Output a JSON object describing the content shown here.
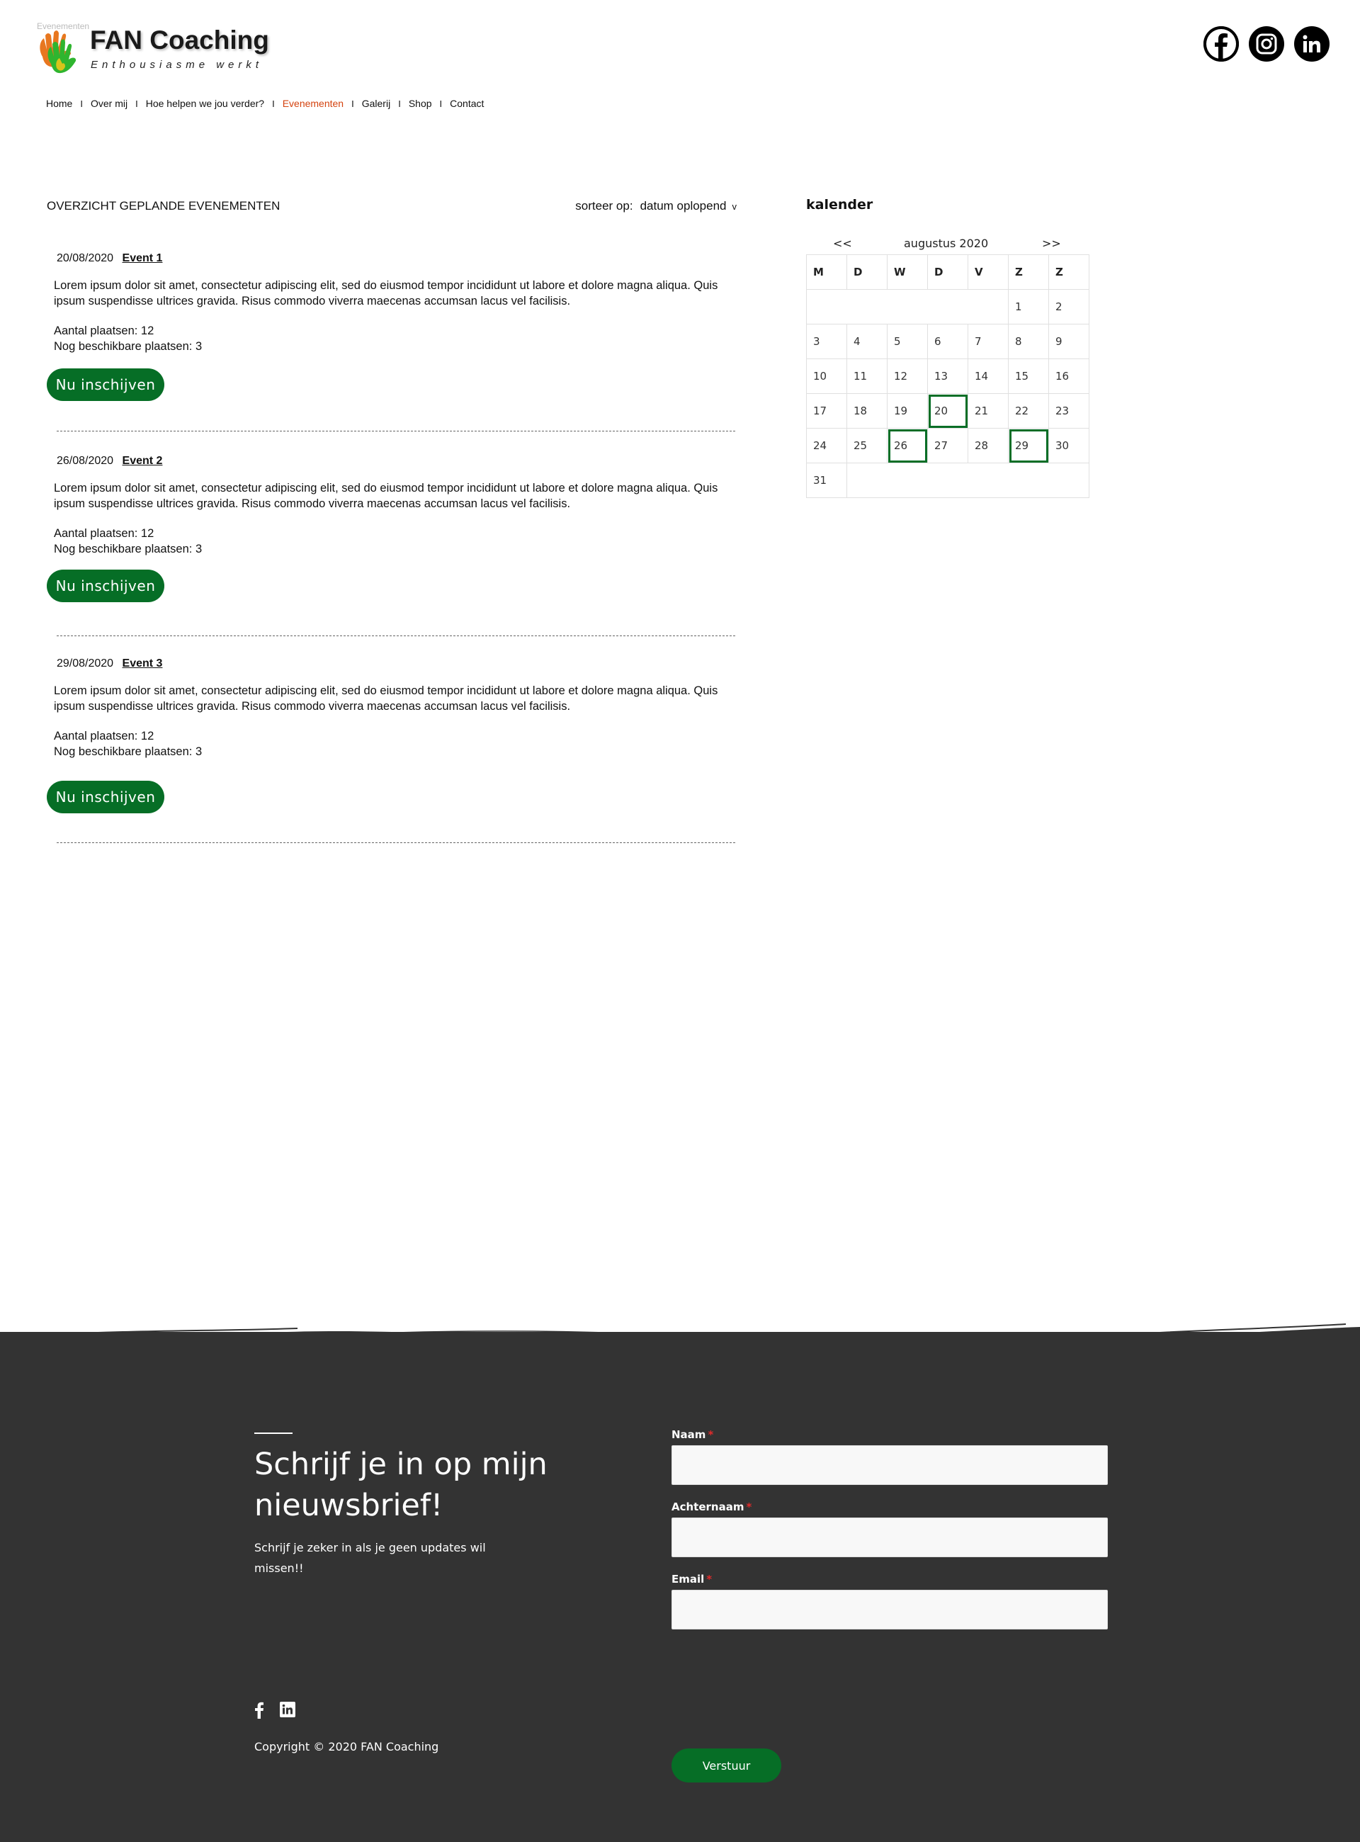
{
  "header": {
    "corner_label": "Evenementen",
    "brand_title": "FAN Coaching",
    "brand_tagline": "Enthousiasme werkt",
    "social": [
      "facebook-icon",
      "instagram-icon",
      "linkedin-icon"
    ]
  },
  "nav": {
    "items": [
      {
        "label": "Home"
      },
      {
        "label": "Over mij"
      },
      {
        "label": "Hoe helpen we jou verder?"
      },
      {
        "label": "Evenementen",
        "active": true
      },
      {
        "label": "Galerij"
      },
      {
        "label": "Shop"
      },
      {
        "label": "Contact"
      }
    ],
    "separator": "I",
    "active_color": "#d4430f"
  },
  "events_section": {
    "title": "OVERZICHT GEPLANDE  EVENEMENTEN",
    "sort_label": "sorteer op:",
    "sort_value": "datum oplopend",
    "sort_chevron": "v"
  },
  "events": [
    {
      "date": "20/08/2020",
      "name": "Event 1",
      "description": "Lorem ipsum dolor sit amet, consectetur adipiscing elit, sed do eiusmod tempor incididunt ut labore et dolore magna aliqua. Quis ipsum suspendisse ultrices gravida. Risus commodo viverra maecenas accumsan lacus vel facilisis.",
      "places": "Aantal plaatsen: 12",
      "available": "Nog beschikbare plaatsen: 3",
      "button": "Nu inschijven"
    },
    {
      "date": "26/08/2020",
      "name": "Event 2",
      "description": "Lorem ipsum dolor sit amet, consectetur adipiscing elit, sed do eiusmod tempor incididunt ut labore et dolore magna aliqua. Quis ipsum suspendisse ultrices gravida. Risus commodo viverra maecenas accumsan lacus vel facilisis.",
      "places": "Aantal plaatsen: 12",
      "available": "Nog beschikbare plaatsen: 3",
      "button": "Nu inschijven"
    },
    {
      "date": "29/08/2020",
      "name": "Event 3",
      "description": "Lorem ipsum dolor sit amet, consectetur adipiscing elit, sed do eiusmod tempor incididunt ut labore et dolore magna aliqua. Quis ipsum suspendisse ultrices gravida. Risus commodo viverra maecenas accumsan lacus vel facilisis.",
      "places": "Aantal plaatsen: 12",
      "available": "Nog beschikbare plaatsen: 3",
      "button": "Nu inschijven"
    }
  ],
  "calendar": {
    "title": "kalender",
    "prev": "<<",
    "month": "augustus 2020",
    "next": ">>",
    "weekdays": [
      "M",
      "D",
      "W",
      "D",
      "V",
      "Z",
      "Z"
    ],
    "first_weekday_index": 5,
    "days_in_month": 31,
    "event_days": [
      20,
      26,
      29
    ],
    "highlight_color": "#066e26"
  },
  "footer": {
    "heading": "Schrijf je in op mijn nieuwsbrief!",
    "subtext": "Schrijf je zeker in als je geen updates wil missen!!",
    "copyright": "Copyright © 2020 FAN Coaching",
    "social": [
      "facebook-icon",
      "linkedin-icon"
    ],
    "background": "#333333",
    "form": {
      "fields": [
        {
          "label": "Naam",
          "required": "*",
          "value": ""
        },
        {
          "label": "Achternaam",
          "required": "*",
          "value": ""
        },
        {
          "label": "Email",
          "required": "*",
          "value": ""
        }
      ],
      "submit": "Verstuur"
    }
  },
  "colors": {
    "brand_green": "#066e26",
    "nav_active": "#d4430f",
    "footer_bg": "#333333"
  }
}
